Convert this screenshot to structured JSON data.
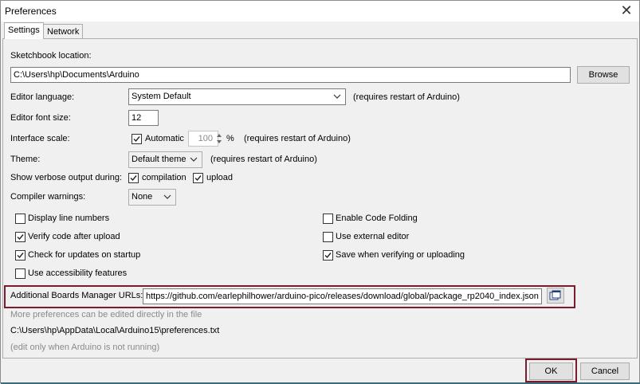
{
  "window": {
    "title": "Preferences",
    "close_glyph": "✕"
  },
  "tabs": [
    {
      "label": "Settings",
      "active": true
    },
    {
      "label": "Network",
      "active": false
    }
  ],
  "sketchbook": {
    "label": "Sketchbook location:",
    "value": "C:\\Users\\hp\\Documents\\Arduino",
    "browse_label": "Browse"
  },
  "editor_language": {
    "label": "Editor language:",
    "value": "System Default",
    "note": "(requires restart of Arduino)"
  },
  "editor_font_size": {
    "label": "Editor font size:",
    "value": "12"
  },
  "interface_scale": {
    "label": "Interface scale:",
    "automatic_label": "Automatic",
    "automatic_checked": true,
    "value": "100",
    "unit": "%",
    "note": "(requires restart of Arduino)"
  },
  "theme": {
    "label": "Theme:",
    "value": "Default theme",
    "note": "(requires restart of Arduino)"
  },
  "verbose": {
    "label": "Show verbose output during:",
    "compilation_label": "compilation",
    "compilation_checked": true,
    "upload_label": "upload",
    "upload_checked": true
  },
  "compiler_warnings": {
    "label": "Compiler warnings:",
    "value": "None"
  },
  "options_left": [
    {
      "label": "Display line numbers",
      "checked": false
    },
    {
      "label": "Verify code after upload",
      "checked": true
    },
    {
      "label": "Check for updates on startup",
      "checked": true
    },
    {
      "label": "Use accessibility features",
      "checked": false
    }
  ],
  "options_right": [
    {
      "label": "Enable Code Folding",
      "checked": false
    },
    {
      "label": "Use external editor",
      "checked": false
    },
    {
      "label": "Save when verifying or uploading",
      "checked": true
    }
  ],
  "boards_manager": {
    "label": "Additional Boards Manager URLs:",
    "value": "https://github.com/earlephilhower/arduino-pico/releases/download/global/package_rp2040_index.json",
    "highlight_color": "#7b1c2c"
  },
  "info": {
    "more_prefs": "More preferences can be edited directly in the file",
    "prefs_path": "C:\\Users\\hp\\AppData\\Local\\Arduino15\\preferences.txt",
    "edit_note": "(edit only when Arduino is not running)"
  },
  "buttons": {
    "ok": "OK",
    "cancel": "Cancel"
  },
  "icons": {
    "close": "close-icon",
    "dropdown": "chevron-down-icon",
    "spinner": "spinner-arrows-icon",
    "check": "check-icon",
    "list_editor": "window-list-icon"
  }
}
